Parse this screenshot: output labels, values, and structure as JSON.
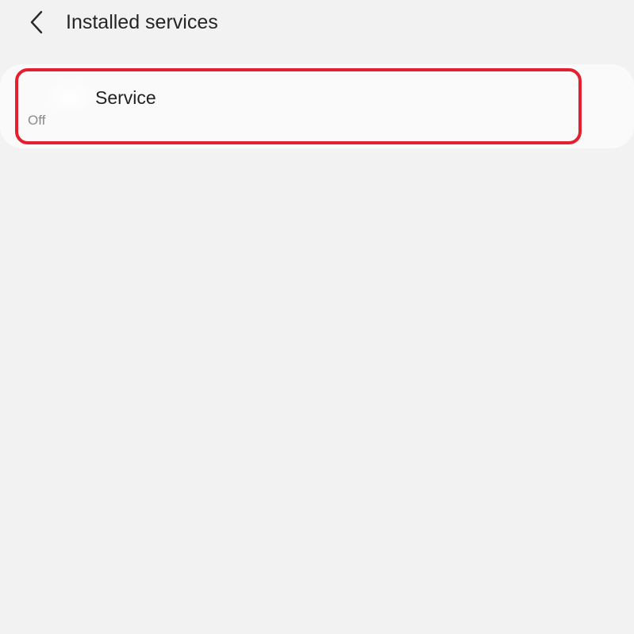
{
  "header": {
    "back_icon": "chevron-left-icon",
    "title": "Installed services"
  },
  "services": [
    {
      "name": "Service",
      "status": "Off",
      "icon": "app-icon"
    }
  ],
  "colors": {
    "background": "#f2f2f2",
    "card": "#fafafa",
    "highlight_border": "#e5202e",
    "secondary_text": "#8a8a8a"
  }
}
